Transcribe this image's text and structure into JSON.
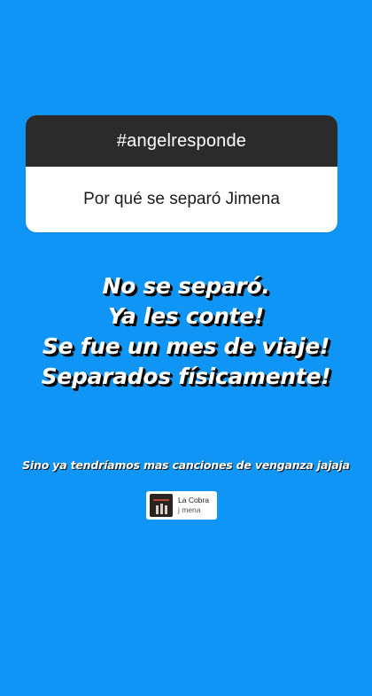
{
  "question": {
    "header": "#angelresponde",
    "text": "Por qué se separó Jimena"
  },
  "answer": {
    "lines": [
      "No se separó.",
      "Ya les conte!",
      "Se fue un mes de viaje!",
      "Separados físicamente!"
    ]
  },
  "caption": "Sino ya tendríamos mas canciones de venganza jajaja",
  "music": {
    "title": "La Cobra",
    "artist": "j mena",
    "icon": "album-art-icon"
  },
  "colors": {
    "background": "#0f95f5",
    "header": "#2b2b2b",
    "card": "#ffffff",
    "text_shadow": "#0a0a0a"
  }
}
